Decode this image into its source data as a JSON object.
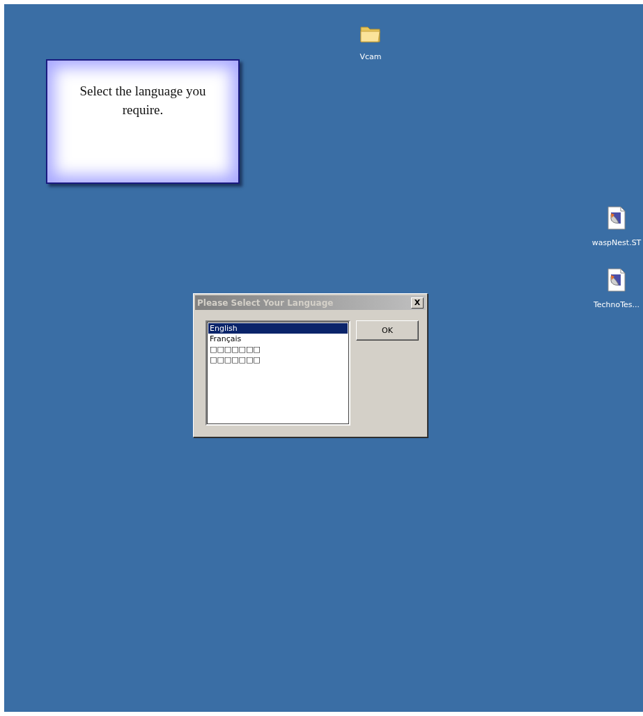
{
  "desktop_icons": [
    {
      "kind": "folder",
      "label": "Vcam"
    },
    {
      "kind": "document",
      "label": "waspNest.ST"
    },
    {
      "kind": "document",
      "label": "TechnoTes..."
    }
  ],
  "info_card": {
    "text": "Select the language you require."
  },
  "dialog": {
    "title": "Please Select Your Language",
    "close": "X",
    "languages": [
      {
        "label": "English",
        "selected": true
      },
      {
        "label": "Français",
        "selected": false
      },
      {
        "label": "□□□□□□□",
        "selected": false
      },
      {
        "label": "□□□□□□□",
        "selected": false
      }
    ],
    "ok_button": "OK"
  }
}
